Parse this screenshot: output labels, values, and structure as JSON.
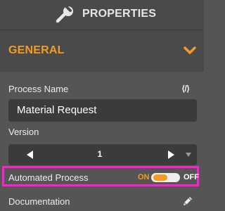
{
  "header": {
    "title": "PROPERTIES",
    "icon": "wrench-icon"
  },
  "section": {
    "title": "GENERAL",
    "icon": "chevron-down-icon",
    "accent_color": "#f59a23"
  },
  "process_name": {
    "label": "Process Name",
    "value": "Material Request",
    "icon": "code-icon",
    "icon_text": "⟨/⟩"
  },
  "version": {
    "label": "Version",
    "value": "1",
    "prev_icon": "triangle-left-icon",
    "next_icon": "triangle-right-icon",
    "dropdown_icon": "caret-down-icon"
  },
  "automated_process": {
    "label": "Automated Process",
    "on_label": "ON",
    "off_label": "OFF",
    "state": "on",
    "highlight_color": "#ff1fd0"
  },
  "documentation": {
    "label": "Documentation",
    "icon": "pencil-icon"
  }
}
